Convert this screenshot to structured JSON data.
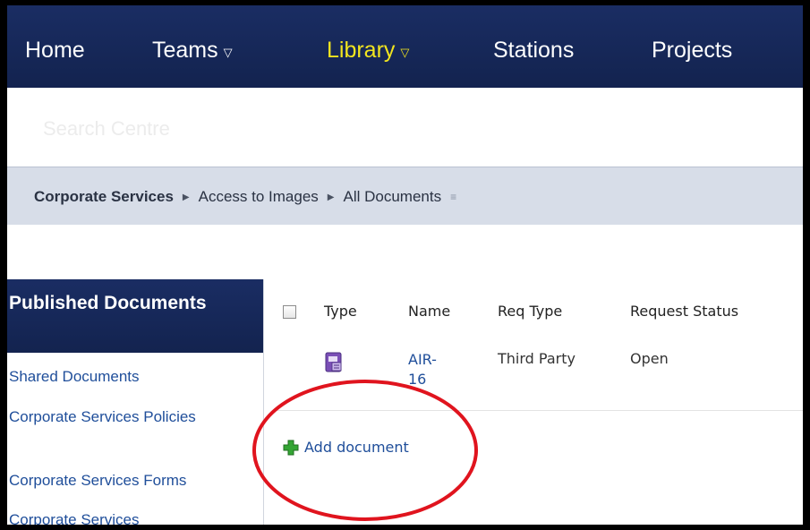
{
  "nav": {
    "items": [
      {
        "label": "Home"
      },
      {
        "label": "Teams",
        "has_menu": true
      },
      {
        "label": "Library",
        "has_menu": true,
        "active": true
      },
      {
        "label": "Stations"
      },
      {
        "label": "Projects"
      }
    ],
    "caret": "▽"
  },
  "search": {
    "placeholder": "Search Centre"
  },
  "breadcrumb": {
    "items": [
      "Corporate Services",
      "Access to Images",
      "All Documents"
    ],
    "separator": "▶",
    "menu_caret": "≡"
  },
  "sidebar": {
    "heading": "Published Documents",
    "links": [
      "Shared Documents",
      "Corporate Services Policies",
      "Corporate Services Forms",
      "Corporate Services"
    ]
  },
  "list": {
    "columns": [
      "Type",
      "Name",
      "Req Type",
      "Request Status"
    ],
    "rows": [
      {
        "type_icon": "document-icon",
        "name": "AIR-16",
        "req_type": "Third Party",
        "request_status": "Open"
      }
    ]
  },
  "add_document": {
    "label": "Add document",
    "icon": "plus-icon"
  },
  "colors": {
    "nav_bg": "#1a2d63",
    "nav_active": "#f2e51f",
    "link": "#1f4e9a",
    "annotation": "#e0141e"
  }
}
